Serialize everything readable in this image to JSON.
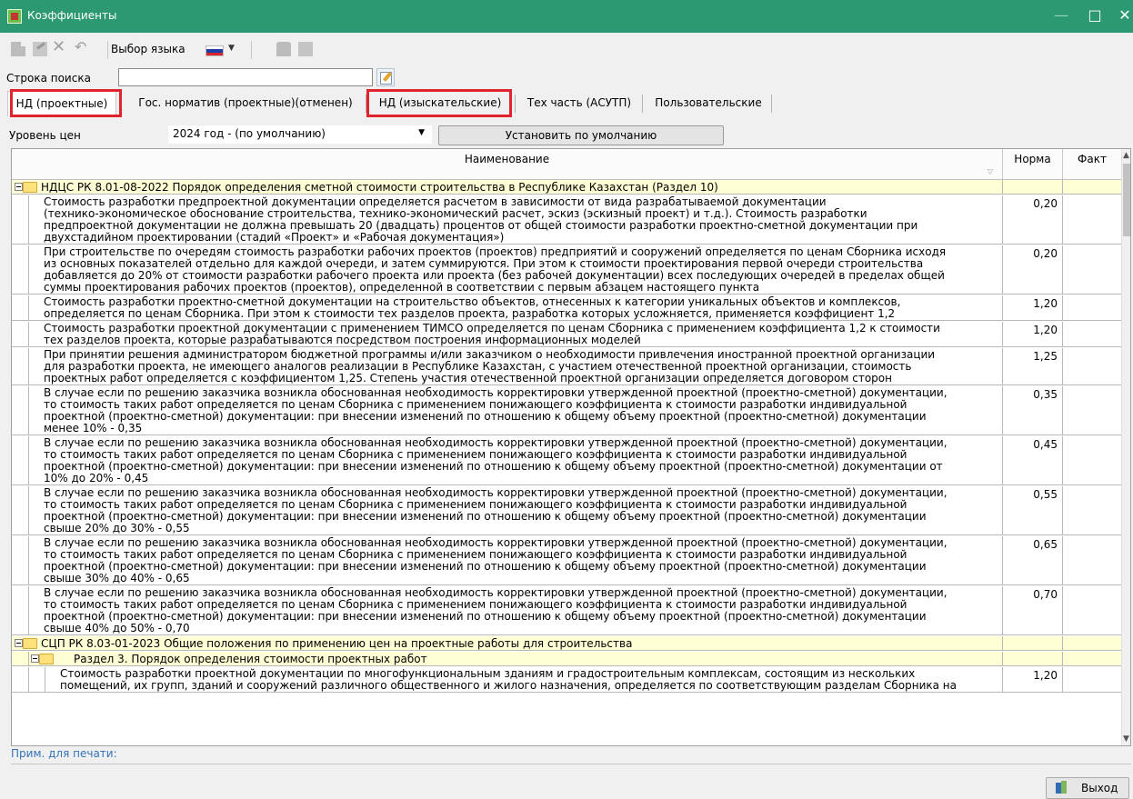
{
  "window": {
    "title": "Коэффициенты",
    "min": "—",
    "max": "□",
    "close": "✕"
  },
  "toolbar": {
    "language_label": "Выбор языка",
    "icons": [
      "new-doc-icon",
      "edit-icon",
      "delete-icon",
      "undo-icon",
      "language-flag-icon",
      "stamp-icon",
      "note-icon"
    ]
  },
  "search": {
    "label": "Строка поиска",
    "value": "",
    "placeholder": ""
  },
  "tabs": [
    {
      "label": "НД (проектные)",
      "active": true,
      "highlighted": true
    },
    {
      "label": "Гос. норматив (проектные)(отменен)",
      "active": false,
      "highlighted": false
    },
    {
      "label": "НД (изыскательские)",
      "active": false,
      "highlighted": true
    },
    {
      "label": "Тех часть (АСУТП)",
      "active": false,
      "highlighted": false
    },
    {
      "label": "Пользовательские",
      "active": false,
      "highlighted": false
    }
  ],
  "price_level": {
    "label": "Уровень цен",
    "value": "2024 год - (по умолчанию)",
    "set_default_button": "Установить по умолчанию"
  },
  "grid": {
    "headers": {
      "name": "Наименование",
      "norm": "Норма",
      "fact": "Факт"
    },
    "rows": [
      {
        "type": "group",
        "level": 0,
        "text": "НДЦС РК 8.01-08-2022 Порядок определения сметной стоимости строительства в Республике Казахстан (Раздел 10)",
        "norm": "",
        "fact": ""
      },
      {
        "type": "item",
        "level": 0,
        "text": "Стоимость разработки предпроектной документации определяется расчетом в зависимости от вида разрабатываемой документации\n(технико-экономическое обоснование строительства, технико-экономический расчет, эскиз (эскизный проект) и т.д.). Стоимость разработки\nпредпроектной документации не должна превышать 20 (двадцать) процентов от общей стоимости разработки проектно-сметной документации при\nдвухстадийном проектировании (стадий «Проект» и «Рабочая документация»)",
        "norm": "0,20",
        "fact": ""
      },
      {
        "type": "item",
        "level": 0,
        "text": "При строительстве по очередям стоимость разработки рабочих проектов (проектов) предприятий и сооружений определяется по ценам Сборника исходя\nиз основных показателей отдельно для каждой очереди, и затем суммируются. При этом к стоимости проектирования первой очереди строительства\nдобавляется до 20% от стоимости разработки рабочего проекта или проекта (без рабочей документации) всех последующих очередей в пределах общей\nсуммы проектирования рабочих проектов (проектов), определенной в соответствии с первым абзацем настоящего пункта",
        "norm": "0,20",
        "fact": ""
      },
      {
        "type": "item",
        "level": 0,
        "text": "Стоимость разработки проектно-сметной документации на строительство объектов, отнесенных к категории уникальных объектов и комплексов,\nопределяется по ценам Сборника. При этом к стоимости тех разделов проекта, разработка которых усложняется, применяется коэффициент 1,2",
        "norm": "1,20",
        "fact": ""
      },
      {
        "type": "item",
        "level": 0,
        "text": "Стоимость разработки проектной документации с применением ТИМСО определяется по ценам Сборника с применением коэффициента 1,2 к стоимости\nтех разделов проекта, которые разрабатываются посредством построения информационных моделей",
        "norm": "1,20",
        "fact": ""
      },
      {
        "type": "item",
        "level": 0,
        "text": "При принятии решения администратором бюджетной программы и/или заказчиком о необходимости привлечения иностранной проектной организации\nдля разработки проекта, не имеющего аналогов реализации в Республике Казахстан, с участием отечественной проектной организации, стоимость\nпроектных работ определяется с коэффициентом 1,25. Степень участия отечественной проектной организации определяется договором сторон",
        "norm": "1,25",
        "fact": ""
      },
      {
        "type": "item",
        "level": 0,
        "text": "В случае если по решению заказчика возникла обоснованная необходимость корректировки утвержденной проектной (проектно-сметной) документации,\nто стоимость таких работ определяется по ценам Сборника с применением понижающего коэффициента к стоимости разработки индивидуальной\nпроектной (проектно-сметной) документации: при внесении изменений по отношению к общему объему проектной (проектно-сметной) документации\nменее 10% - 0,35",
        "norm": "0,35",
        "fact": ""
      },
      {
        "type": "item",
        "level": 0,
        "text": "В случае если по решению заказчика возникла обоснованная необходимость корректировки утвержденной проектной (проектно-сметной) документации,\nто стоимость таких работ определяется по ценам Сборника с применением понижающего коэффициента к стоимости разработки индивидуальной\nпроектной (проектно-сметной) документации: при внесении изменений по отношению к общему объему проектной (проектно-сметной) документации от\n10% до 20% - 0,45",
        "norm": "0,45",
        "fact": ""
      },
      {
        "type": "item",
        "level": 0,
        "text": "В случае если по решению заказчика возникла обоснованная необходимость корректировки утвержденной проектной (проектно-сметной) документации,\nто стоимость таких работ определяется по ценам Сборника с применением понижающего коэффициента к стоимости разработки индивидуальной\nпроектной (проектно-сметной) документации: при внесении изменений по отношению к общему объему проектной (проектно-сметной) документации\nсвыше 20% до 30% - 0,55",
        "norm": "0,55",
        "fact": ""
      },
      {
        "type": "item",
        "level": 0,
        "text": "В случае если по решению заказчика возникла обоснованная необходимость корректировки утвержденной проектной (проектно-сметной) документации,\nто стоимость таких работ определяется по ценам Сборника с применением понижающего коэффициента к стоимости разработки индивидуальной\nпроектной (проектно-сметной) документации: при внесении изменений по отношению к общему объему проектной (проектно-сметной) документации\nсвыше 30% до 40% - 0,65",
        "norm": "0,65",
        "fact": ""
      },
      {
        "type": "item",
        "level": 0,
        "text": "В случае если по решению заказчика возникла обоснованная необходимость корректировки утвержденной проектной (проектно-сметной) документации,\nто стоимость таких работ определяется по ценам Сборника с применением понижающего коэффициента к стоимости разработки индивидуальной\nпроектной (проектно-сметной) документации: при внесении изменений по отношению к общему объему проектной (проектно-сметной) документации\nсвыше 40% до 50% - 0,70",
        "norm": "0,70",
        "fact": ""
      },
      {
        "type": "group",
        "level": 0,
        "text": "СЦП РК 8.03-01-2023 Общие положения по применению цен на проектные работы для строительства",
        "norm": "",
        "fact": ""
      },
      {
        "type": "group",
        "level": 1,
        "text": "Раздел 3. Порядок определения стоимости проектных работ",
        "norm": "",
        "fact": ""
      },
      {
        "type": "item",
        "level": 1,
        "text": "Стоимость разработки проектной документации по многофункциональным зданиям и градостроительным комплексам, состоящим из нескольких\nпомещений, их групп, зданий и сооружений различного общественного и жилого назначения, определяется по соответствующим разделам Сборника на",
        "norm": "1,20",
        "fact": ""
      }
    ]
  },
  "print_note_label": "Прим. для печати:",
  "exit_button": "Выход",
  "colors": {
    "titlebar": "#2d9972",
    "group_row": "#ffffd5",
    "highlight": "#e0242d",
    "link": "#3373b7"
  }
}
